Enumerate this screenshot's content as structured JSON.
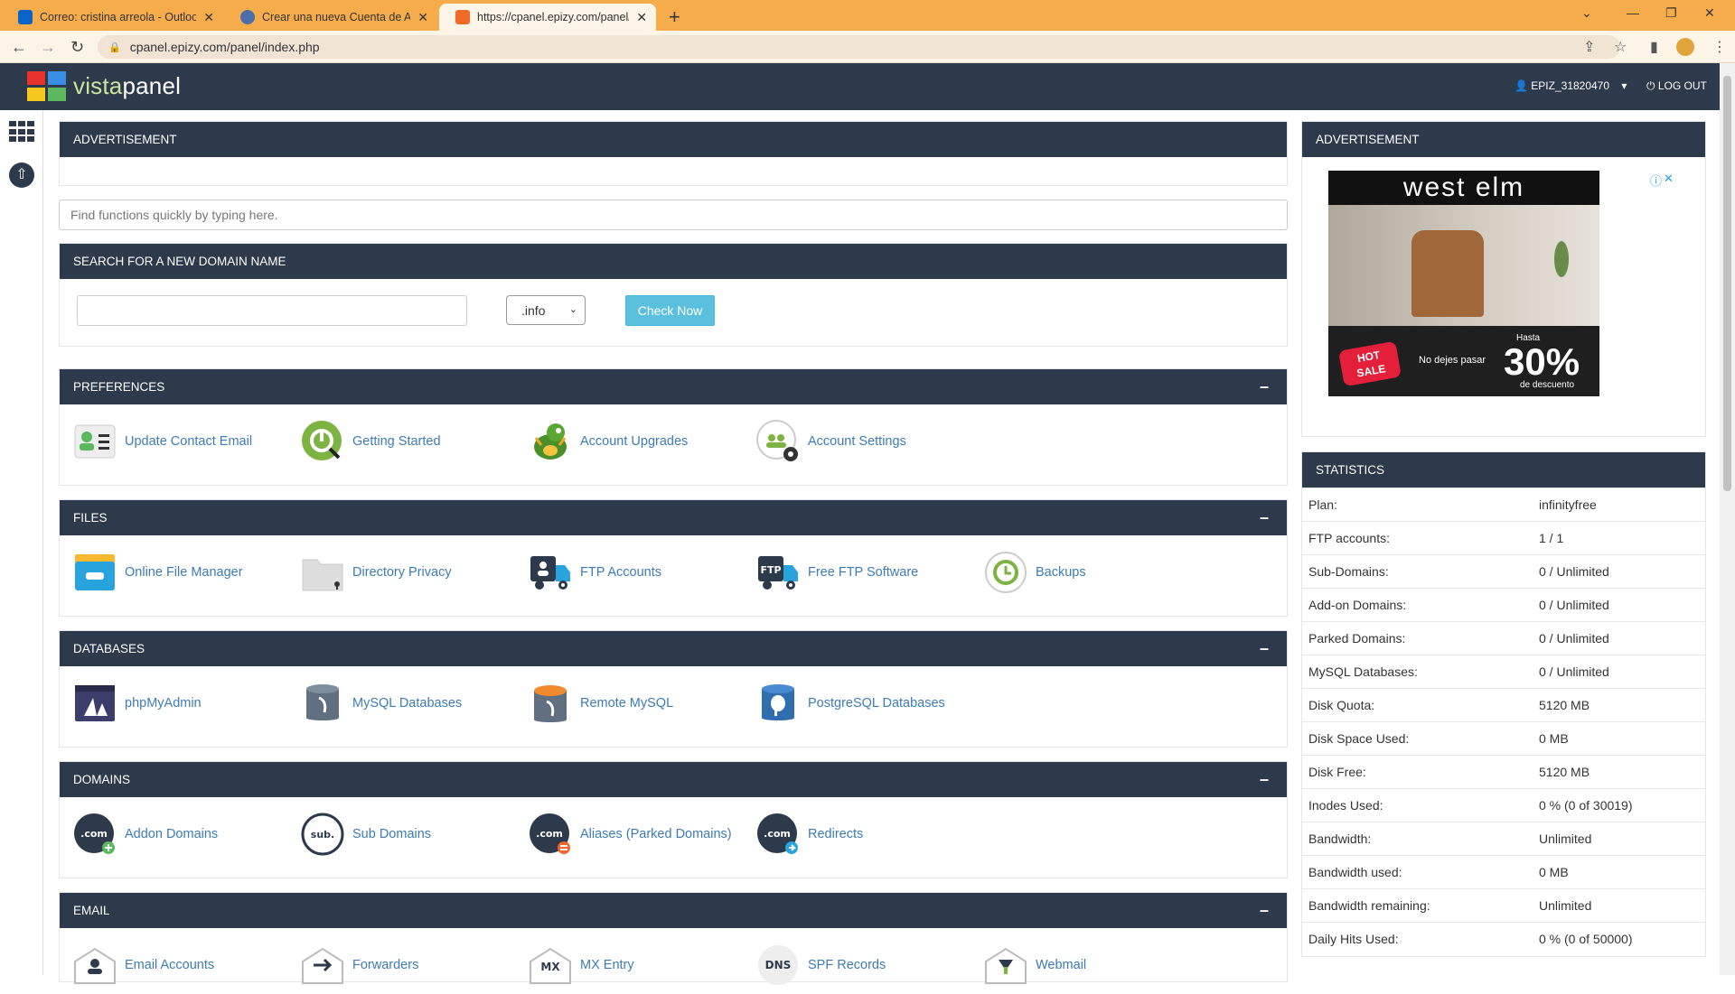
{
  "browser": {
    "tabs": [
      {
        "title": "Correo: cristina arreola - Outlook"
      },
      {
        "title": "Crear una nueva Cuenta de Aloja"
      },
      {
        "title": "https://cpanel.epizy.com/panel/i"
      }
    ],
    "url": "cpanel.epizy.com/panel/index.php"
  },
  "header": {
    "logo_a": "vista",
    "logo_b": "panel",
    "username": "EPIZ_31820470",
    "logout_label": "LOG OUT"
  },
  "advert": {
    "title": "ADVERTISEMENT",
    "side_title": "ADVERTISEMENT",
    "brand": "west elm",
    "hot": "HOT",
    "sale": "SALE",
    "tagline": "No dejes pasar",
    "hasta": "Hasta",
    "percent": "30%",
    "desc": "de descuento"
  },
  "search": {
    "placeholder": "Find functions quickly by typing here."
  },
  "domain_search": {
    "title": "SEARCH FOR A NEW DOMAIN NAME",
    "tld": ".info",
    "button": "Check Now"
  },
  "sections": {
    "preferences": {
      "title": "PREFERENCES",
      "items": [
        "Update Contact Email",
        "Getting Started",
        "Account Upgrades",
        "Account Settings"
      ]
    },
    "files": {
      "title": "FILES",
      "items": [
        "Online File Manager",
        "Directory Privacy",
        "FTP Accounts",
        "Free FTP Software",
        "Backups"
      ]
    },
    "databases": {
      "title": "DATABASES",
      "items": [
        "phpMyAdmin",
        "MySQL Databases",
        "Remote MySQL",
        "PostgreSQL Databases"
      ]
    },
    "domains": {
      "title": "DOMAINS",
      "items": [
        "Addon Domains",
        "Sub Domains",
        "Aliases (Parked Domains)",
        "Redirects"
      ]
    },
    "email": {
      "title": "EMAIL",
      "items": [
        "Email Accounts",
        "Forwarders",
        "MX Entry",
        "SPF Records",
        "Webmail"
      ]
    }
  },
  "icon_text": {
    "com": ".com",
    "sub": "sub.",
    "mx": "MX",
    "dns": "DNS",
    "ftp": "FTP"
  },
  "statistics": {
    "title": "STATISTICS",
    "rows": [
      {
        "label": "Plan:",
        "value": "infinityfree"
      },
      {
        "label": "FTP accounts:",
        "value": "1 / 1"
      },
      {
        "label": "Sub-Domains:",
        "value": "0 / Unlimited"
      },
      {
        "label": "Add-on Domains:",
        "value": "0 / Unlimited"
      },
      {
        "label": "Parked Domains:",
        "value": "0 / Unlimited"
      },
      {
        "label": "MySQL Databases:",
        "value": "0 / Unlimited"
      },
      {
        "label": "Disk Quota:",
        "value": "5120 MB"
      },
      {
        "label": "Disk Space Used:",
        "value": "0 MB"
      },
      {
        "label": "Disk Free:",
        "value": "5120 MB"
      },
      {
        "label": "Inodes Used:",
        "value": "0 % (0 of 30019)"
      },
      {
        "label": "Bandwidth:",
        "value": "Unlimited"
      },
      {
        "label": "Bandwidth used:",
        "value": "0 MB"
      },
      {
        "label": "Bandwidth remaining:",
        "value": "Unlimited"
      },
      {
        "label": "Daily Hits Used:",
        "value": "0 % (0 of 50000)"
      }
    ]
  },
  "colors": {
    "header_bg": "#2c3a4b",
    "tabbar": "#f6ac4a",
    "link": "#3c7bb5",
    "check_button": "#5bc0de"
  }
}
